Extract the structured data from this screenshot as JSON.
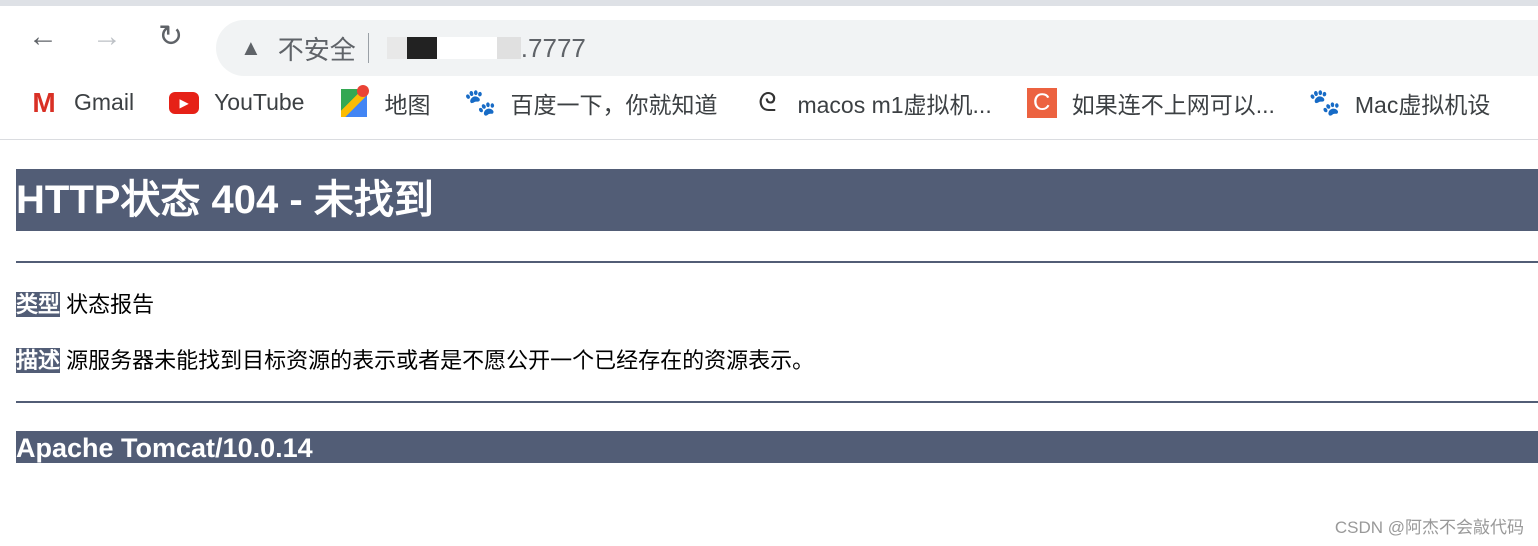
{
  "browser": {
    "security_label": "不安全",
    "url_visible": ".7777",
    "bookmarks": [
      {
        "label": "Gmail",
        "icon": "gmail-icon"
      },
      {
        "label": "YouTube",
        "icon": "youtube-icon"
      },
      {
        "label": "地图",
        "icon": "google-maps-icon"
      },
      {
        "label": "百度一下，你就知道",
        "icon": "baidu-icon"
      },
      {
        "label": "macos m1虚拟机...",
        "icon": "site-icon"
      },
      {
        "label": "如果连不上网可以...",
        "icon": "csdn-icon"
      },
      {
        "label": "Mac虚拟机设",
        "icon": "baidu-icon"
      }
    ]
  },
  "page": {
    "title": "HTTP状态 404 - 未找到",
    "type_label": "类型",
    "type_value": "状态报告",
    "desc_label": "描述",
    "desc_value": "源服务器未能找到目标资源的表示或者是不愿公开一个已经存在的资源表示。",
    "footer": "Apache Tomcat/10.0.14"
  },
  "watermark": "CSDN @阿杰不会敲代码",
  "colors": {
    "header_bg": "#525d76"
  }
}
